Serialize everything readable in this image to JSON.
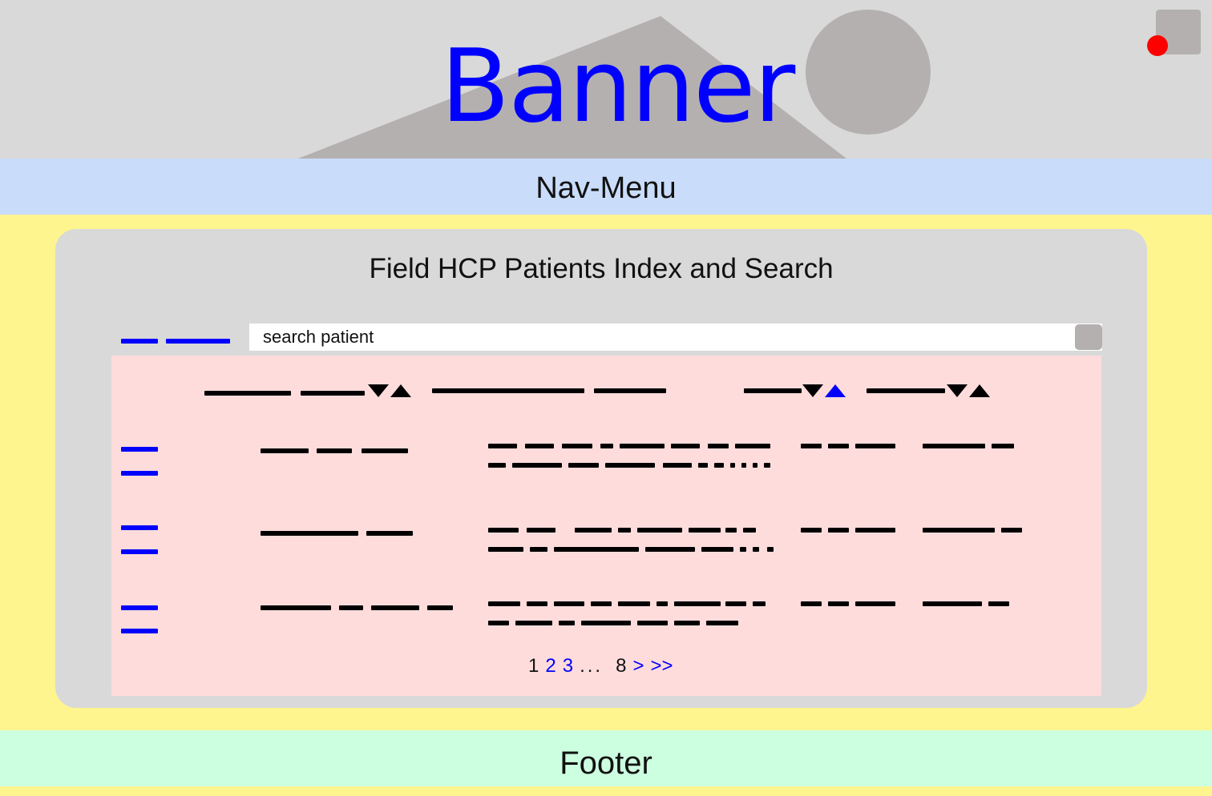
{
  "banner": {
    "title": "Banner",
    "icons": {
      "mountain": "mountain-image-icon",
      "sun": "sun-circle-icon"
    }
  },
  "user": {
    "icon": "user-avatar-icon",
    "status_color": "#ff0000"
  },
  "nav": {
    "label": "Nav-Menu"
  },
  "panel": {
    "title": "Field HCP Patients Index and Search"
  },
  "search": {
    "placeholder": "search patient",
    "button_icon": "search-button-icon"
  },
  "table": {
    "columns": [
      "column-1",
      "column-2",
      "column-3",
      "column-4"
    ],
    "rows": 3,
    "active_sort": {
      "column": 3,
      "direction": "ascending",
      "color": "#0000ff"
    }
  },
  "pagination": {
    "pages": [
      "1",
      "2",
      "3"
    ],
    "ellipsis": "...",
    "last": "8",
    "next": ">",
    "last_page": ">>"
  },
  "footer": {
    "label": "Footer"
  },
  "colors": {
    "banner_bg": "#d9d9d9",
    "nav_bg": "#c9dcfa",
    "page_bg": "#fff58f",
    "panel_bg": "#d9d9d9",
    "table_bg": "#ffdcdc",
    "footer_bg": "#ccffdf",
    "accent": "#0000ff"
  }
}
